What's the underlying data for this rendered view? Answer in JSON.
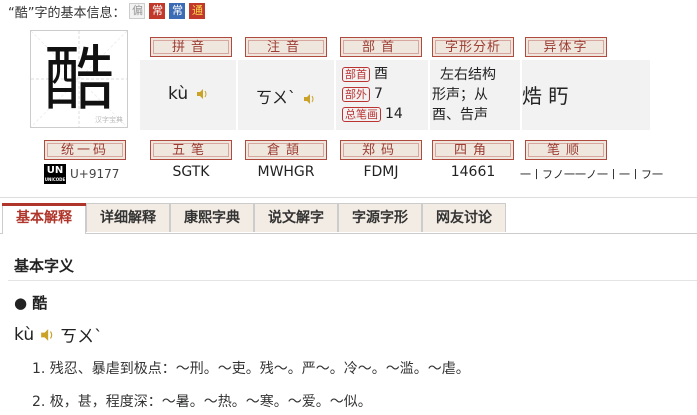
{
  "header": {
    "title": "“酷”字的基本信息：",
    "badges": [
      "偏",
      "常",
      "常",
      "通"
    ]
  },
  "character": {
    "glyph": "酷",
    "watermark": "汉字宝典"
  },
  "labels": {
    "pinyin": "拼音",
    "zhuyin": "注音",
    "bushou": "部首",
    "zixing": "字形分析",
    "yiti": "异体字",
    "tongyi": "统一码",
    "wubi": "五笔",
    "cangjie": "倉頡",
    "zhengma": "郑码",
    "sijiao": "四角",
    "bishun": "笔顺"
  },
  "values": {
    "pinyin": "kù",
    "zhuyin": "ㄎㄨˋ",
    "bushou_label": "部首",
    "bushou": "酉",
    "buwai_label": "部外",
    "buwai": "7",
    "zongbihua_label": "总笔画",
    "zongbihua": "14",
    "zixing_1": "左右结构",
    "zixing_2": "形声；从",
    "zixing_3": "酉、告声",
    "yiti": "焅 䀎",
    "unicode_logo": "UN",
    "unicode_logo_sub": "UNICODE",
    "unicode": "U+9177",
    "wubi": "SGTK",
    "cangjie": "MWHGR",
    "zhengma": "FDMJ",
    "sijiao": "14661",
    "bishun": "一丨フノ一一ノ一丨一丨フ一"
  },
  "tabs": [
    "基本解释",
    "详细解释",
    "康熙字典",
    "说文解字",
    "字源字形",
    "网友讨论"
  ],
  "basic": {
    "section_title": "基本字义",
    "entry": "● 酷",
    "pinyin": "kù",
    "zhuyin": "ㄎㄨˋ",
    "definitions": [
      "1. 残忍、暴虐到极点：～刑。～吏。残～。严～。冷～。～滥。～虐。",
      "2. 极，甚，程度深：～暑。～热。～寒。～爱。～似。"
    ]
  },
  "colors": {
    "accent": "#b0362b",
    "label_bg": "#efe6dd",
    "cell_bg": "#f2f2f2"
  }
}
